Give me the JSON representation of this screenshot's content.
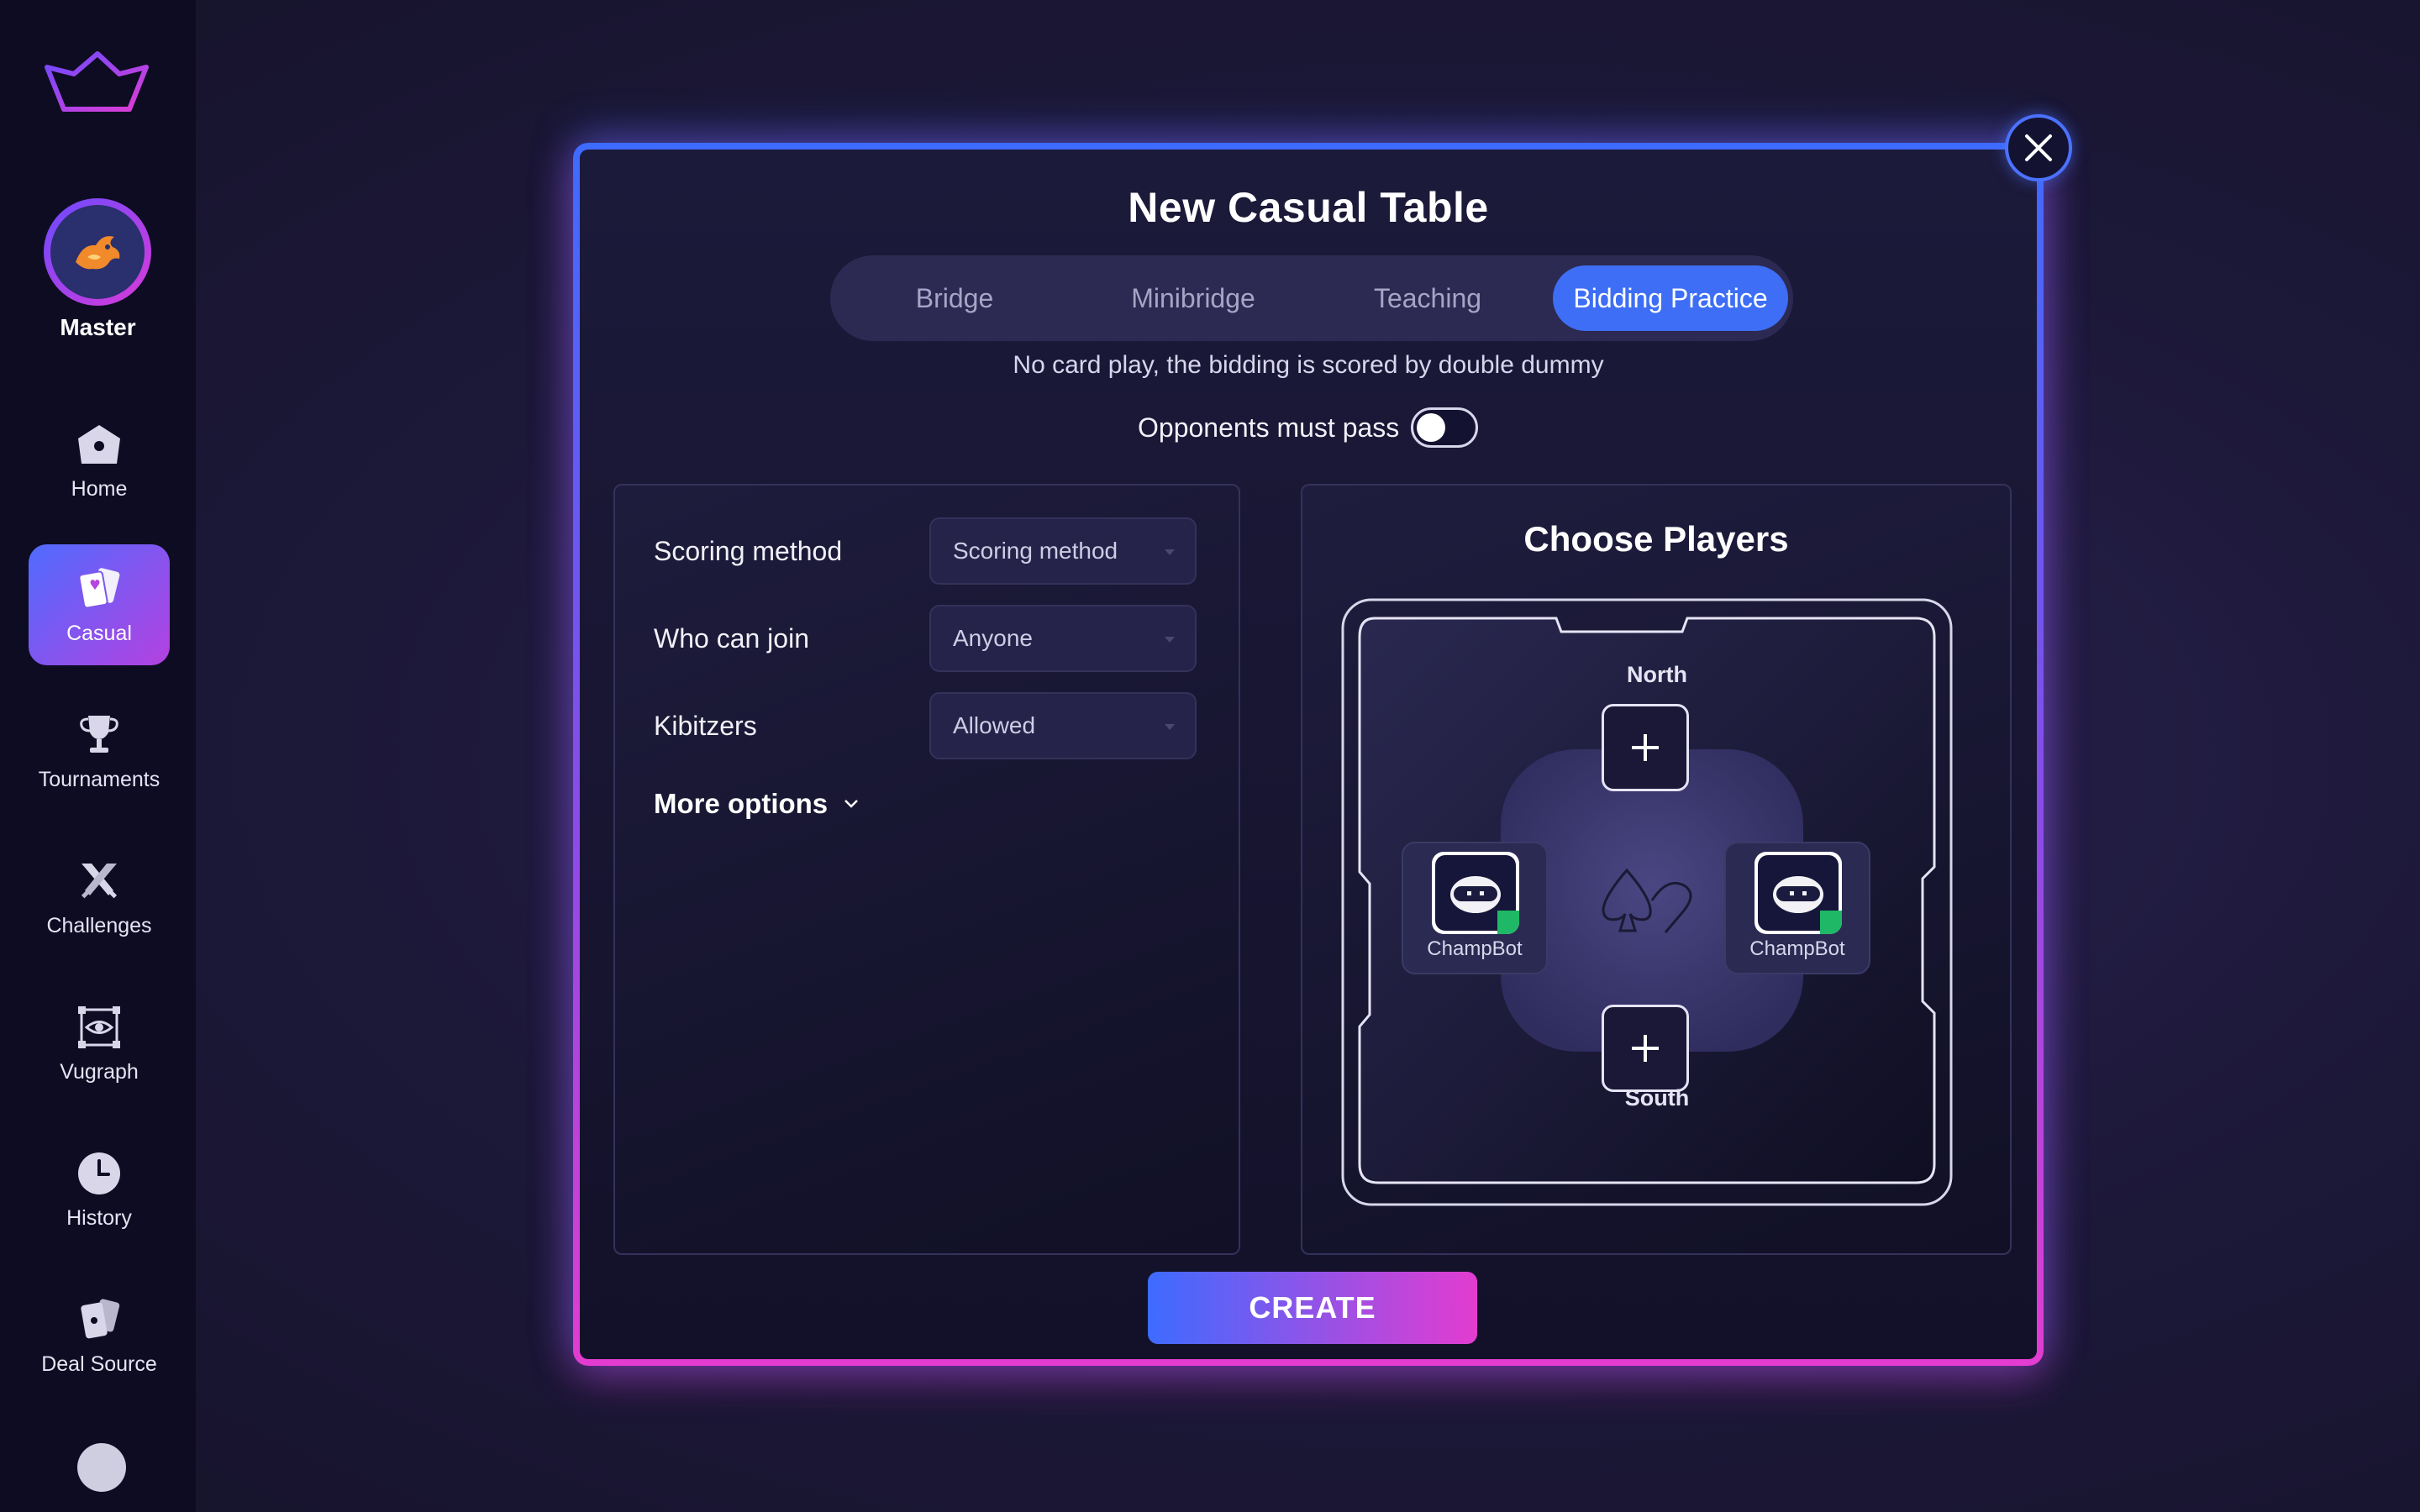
{
  "sidebar": {
    "profile_name": "Master",
    "items": [
      {
        "label": "Home",
        "icon": "home-icon",
        "active": false
      },
      {
        "label": "Casual",
        "icon": "cards-icon",
        "active": true
      },
      {
        "label": "Tournaments",
        "icon": "trophy-icon",
        "active": false
      },
      {
        "label": "Challenges",
        "icon": "crossed-swords-icon",
        "active": false
      },
      {
        "label": "Vugraph",
        "icon": "vugraph-eye-icon",
        "active": false
      },
      {
        "label": "History",
        "icon": "clock-icon",
        "active": false
      },
      {
        "label": "Deal Source",
        "icon": "deal-cards-icon",
        "active": false
      }
    ]
  },
  "modal": {
    "title": "New Casual Table",
    "tabs": [
      {
        "label": "Bridge",
        "active": false
      },
      {
        "label": "Minibridge",
        "active": false
      },
      {
        "label": "Teaching",
        "active": false
      },
      {
        "label": "Bidding Practice",
        "active": true
      }
    ],
    "tab_description": "No card play, the bidding is scored by double dummy",
    "opponents_must_pass": {
      "label": "Opponents must pass",
      "on": false
    },
    "options": {
      "scoring": {
        "label": "Scoring method",
        "value": "Scoring method"
      },
      "who_can_join": {
        "label": "Who can join",
        "value": "Anyone"
      },
      "kibitzers": {
        "label": "Kibitzers",
        "value": "Allowed"
      },
      "more_options": "More options"
    },
    "players": {
      "title": "Choose Players",
      "north": "North",
      "south": "South",
      "west_bot": "ChampBot",
      "east_bot": "ChampBot"
    },
    "create_label": "CREATE"
  },
  "colors": {
    "accent_blue": "#3d6ef5",
    "accent_magenta": "#e33cd0",
    "online_green": "#1fb866"
  }
}
